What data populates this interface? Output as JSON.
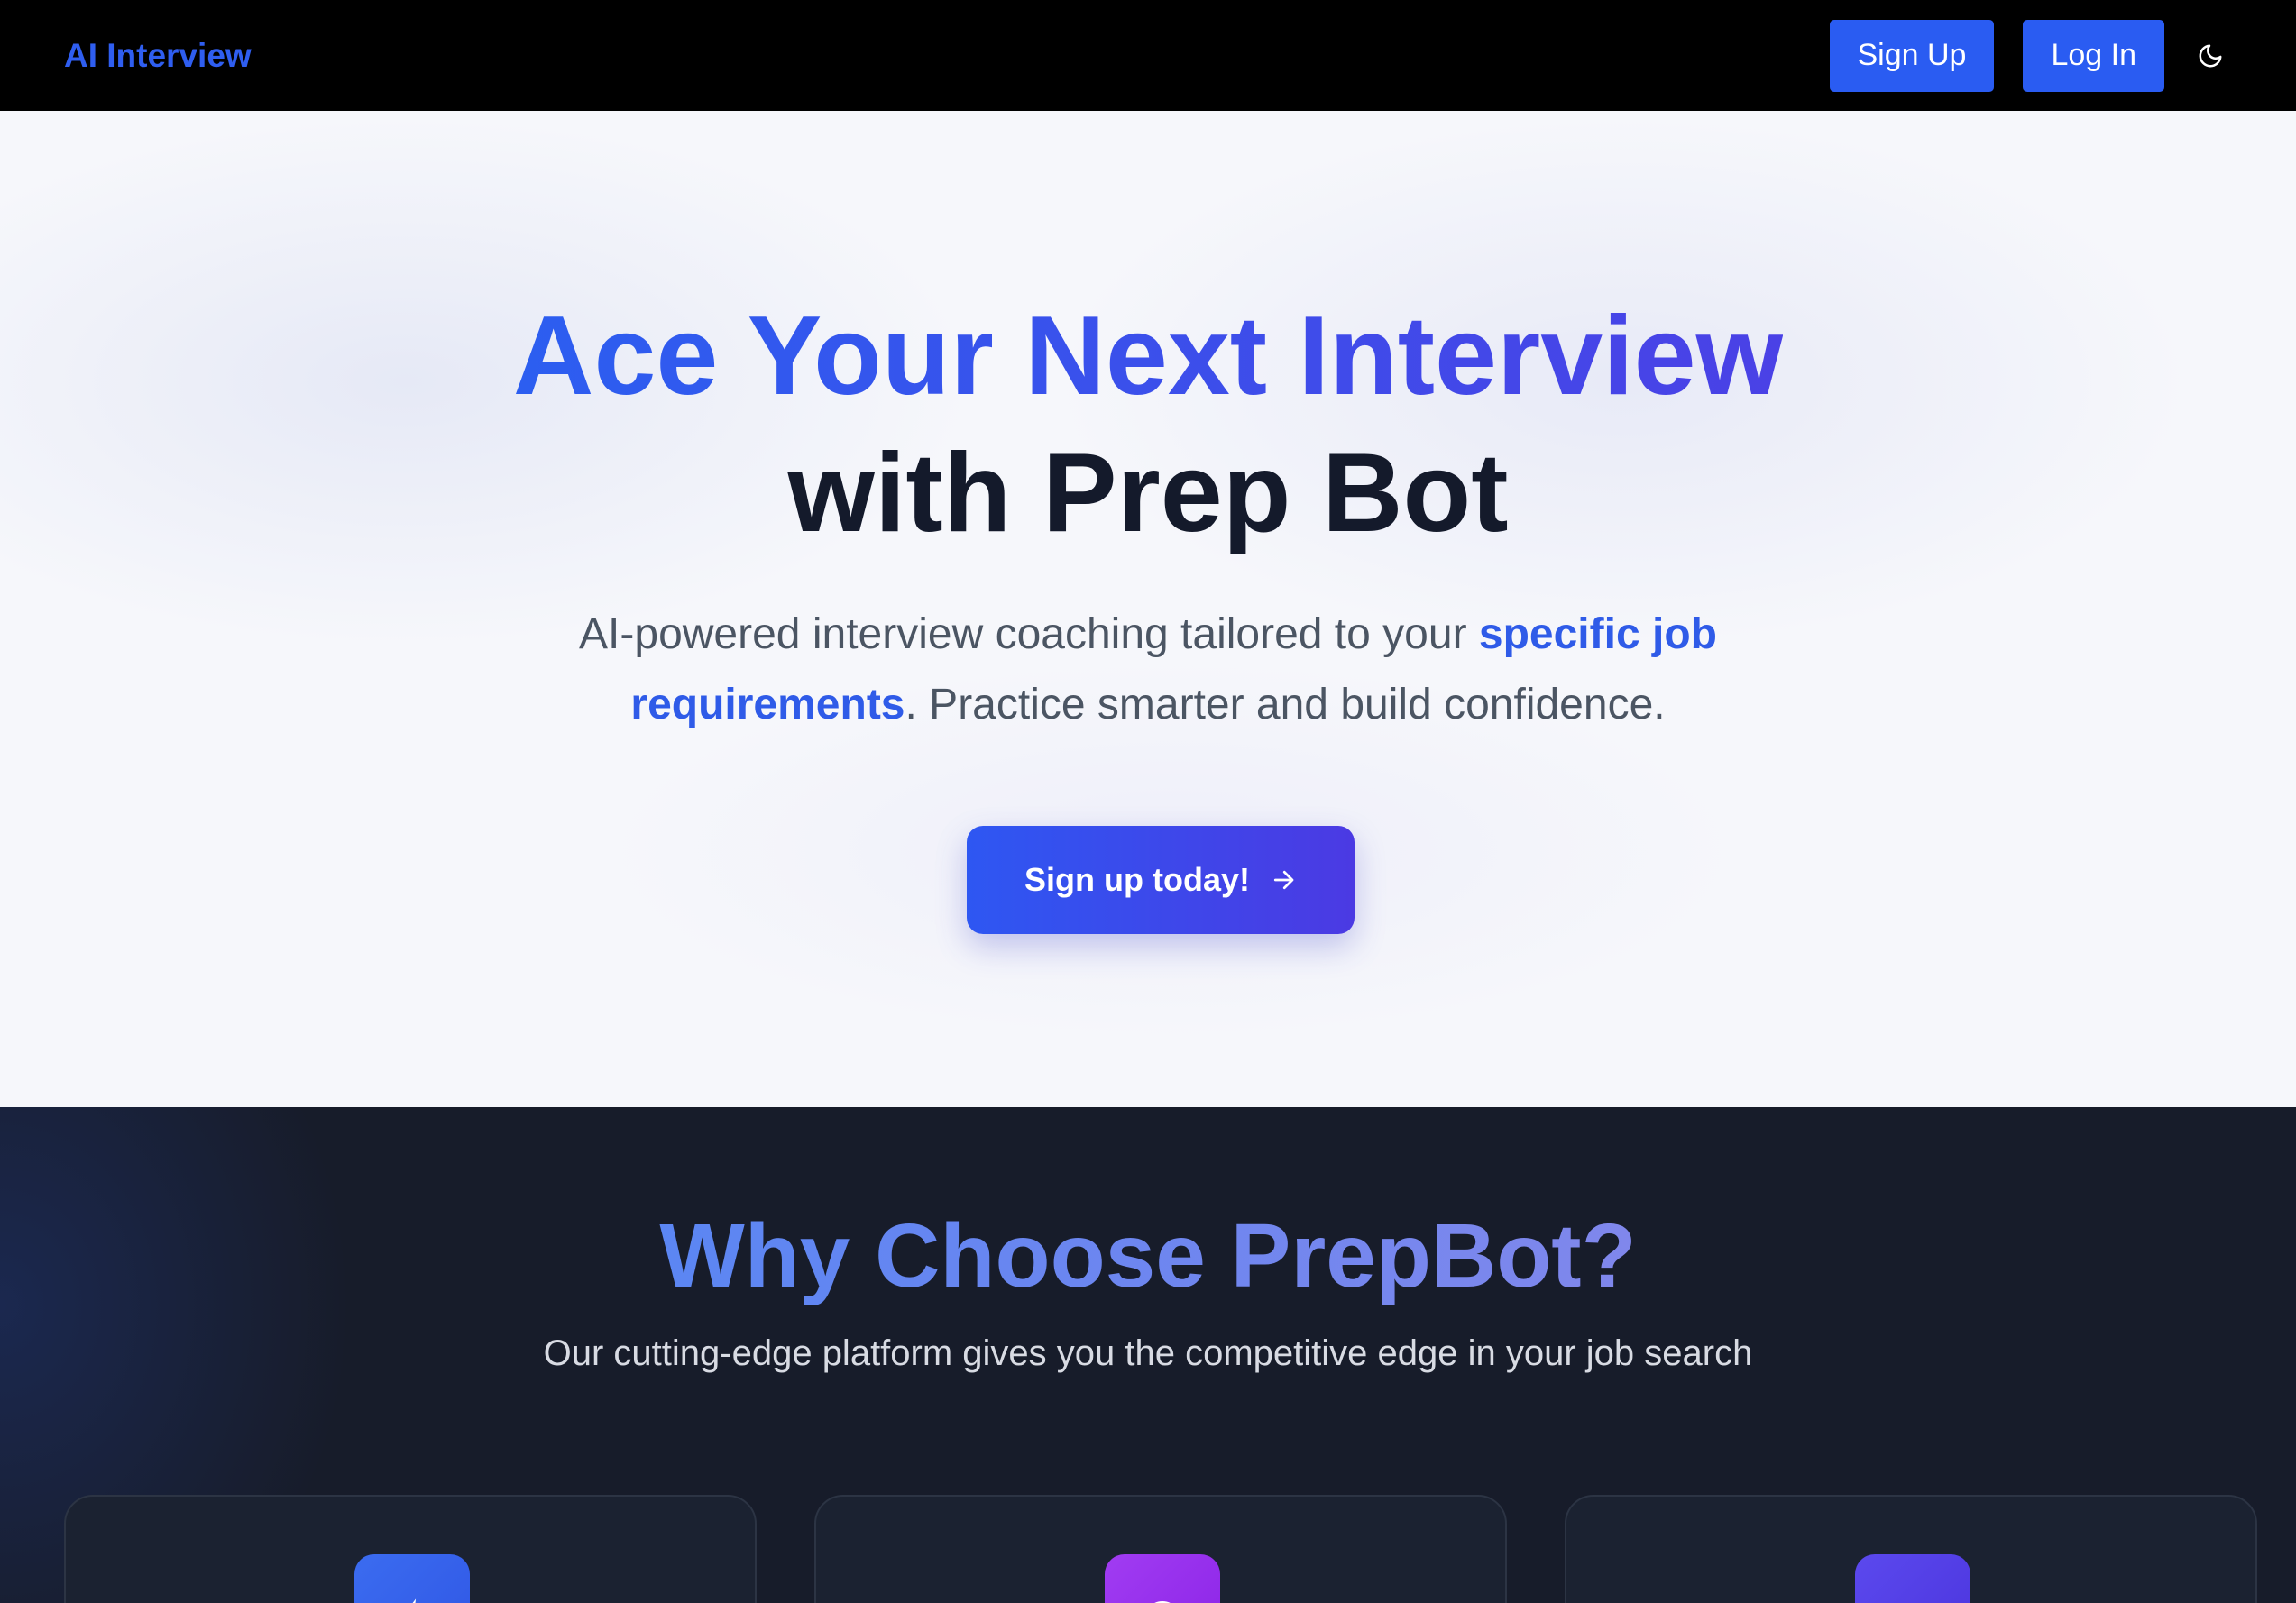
{
  "navbar": {
    "brand": "AI Interview",
    "signup_label": "Sign Up",
    "login_label": "Log In",
    "theme_icon": "moon-icon"
  },
  "hero": {
    "title_line1": "Ace Your Next Interview",
    "title_line2": "with Prep Bot",
    "subtitle_pre": "AI-powered interview coaching tailored to your ",
    "subtitle_highlight": "specific job requirements",
    "subtitle_post": ". Practice smarter and build confidence.",
    "cta_label": "Sign up today!",
    "cta_icon": "arrow-right-icon"
  },
  "features": {
    "title": "Why Choose PrepBot?",
    "subtitle": "Our cutting-edge platform gives you the competitive edge in your job search",
    "cards": [
      {
        "icon": "feature-icon-blue",
        "color": "#3b6cf0"
      },
      {
        "icon": "feature-icon-purple",
        "color": "#9a2fef"
      },
      {
        "icon": "feature-icon-indigo",
        "color": "#5a3fe9"
      }
    ]
  },
  "colors": {
    "primary": "#2a5cf2",
    "nav_bg": "#000000",
    "dark_section_bg": "#171c2a",
    "heading_dark": "#141a2b"
  }
}
